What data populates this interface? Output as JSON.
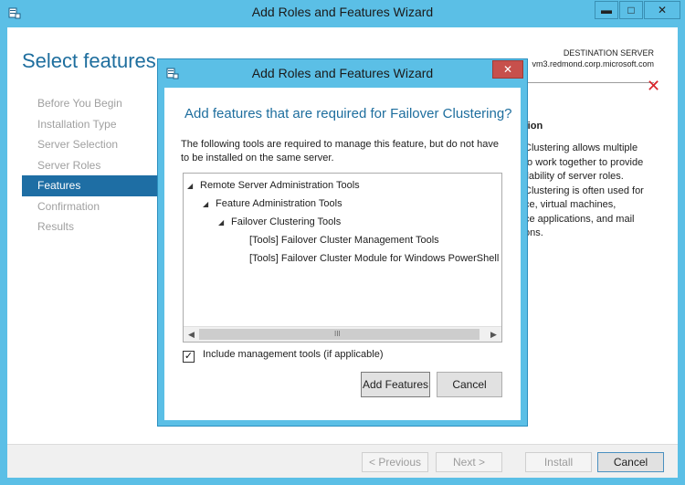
{
  "window": {
    "title": "Add Roles and Features Wizard",
    "controls": {
      "minimize": "▬",
      "maximize": "□",
      "close": "✕"
    }
  },
  "page": {
    "title": "Select features",
    "destination_label": "DESTINATION SERVER",
    "destination_value": "vm3.redmond.corp.microsoft.com",
    "error_icon": "✕"
  },
  "nav": {
    "items": [
      {
        "label": "Before You Begin",
        "active": false
      },
      {
        "label": "Installation Type",
        "active": false
      },
      {
        "label": "Server Selection",
        "active": false
      },
      {
        "label": "Server Roles",
        "active": false
      },
      {
        "label": "Features",
        "active": true
      },
      {
        "label": "Confirmation",
        "active": false
      },
      {
        "label": "Results",
        "active": false
      }
    ]
  },
  "description": {
    "heading": "tion",
    "body": "Clustering allows multiple\nto work together to provide\nilability of server roles.\nClustering is often used for\nce, virtual machines,\nce applications, and mail\nons."
  },
  "footer": {
    "previous": "< Previous",
    "next": "Next >",
    "install": "Install",
    "cancel": "Cancel"
  },
  "dialog": {
    "title": "Add Roles and Features Wizard",
    "close": "✕",
    "heading": "Add features that are required for Failover Clustering?",
    "text": "The following tools are required to manage this feature, but do not have to be installed on the same server.",
    "tree": [
      {
        "label": "Remote Server Administration Tools",
        "expanded": true
      },
      {
        "label": "Feature Administration Tools",
        "expanded": true
      },
      {
        "label": "Failover Clustering Tools",
        "expanded": true
      },
      {
        "label": "[Tools] Failover Cluster Management Tools"
      },
      {
        "label": "[Tools] Failover Cluster Module for Windows PowerShell"
      }
    ],
    "scroll_grip": "III",
    "checkbox": {
      "label": "Include management tools (if applicable)",
      "checked": true,
      "mark": "✓"
    },
    "add_button": "Add Features",
    "cancel_button": "Cancel"
  }
}
